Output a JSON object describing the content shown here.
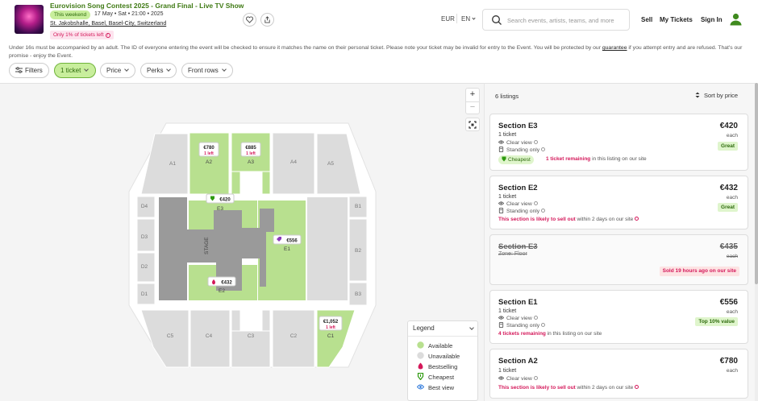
{
  "event": {
    "title": "Eurovision Song Contest 2025 - Grand Final - Live TV Show",
    "badge": "This weekend",
    "date": "17 May • Sat • 21:00 • 2025",
    "venue": "St. Jakobshalle, Basel, Basel-City, Switzerland",
    "tickets_left": "Only 1% of tickets left"
  },
  "header": {
    "currency": "EUR",
    "language": "EN",
    "search_placeholder": "Search events, artists, teams, and more",
    "nav": [
      "Sell",
      "My Tickets",
      "Sign In"
    ]
  },
  "notice": {
    "text_before": "Under 16s must be accompanied by an adult. The ID of everyone entering the event will be checked to ensure it matches the name on their personal ticket. Please note your ticket may be invalid for entry to the Event. You will be protected by our ",
    "link": "guarantee",
    "text_after": " if you attempt entry and are refused. That's our promise - enjoy the Event."
  },
  "filters": [
    "Filters",
    "1 ticket",
    "Price",
    "Perks",
    "Front rows"
  ],
  "map": {
    "stage_label": "STAGE",
    "sections": {
      "A1": "A1",
      "A2": "A2",
      "A3": "A3",
      "A4": "A4",
      "A5": "A5",
      "D4": "D4",
      "D3": "D3",
      "D2": "D2",
      "D1": "D1",
      "B1": "B1",
      "B2": "B2",
      "B3": "B3",
      "E1": "E1",
      "E2": "E2",
      "E3": "E3",
      "C1": "C1",
      "C2": "C2",
      "C3": "C3",
      "C4": "C4",
      "C5": "C5"
    },
    "pins": {
      "a2": {
        "price": "€780",
        "sub": "1 left"
      },
      "a3": {
        "price": "€885",
        "sub": "1 left"
      },
      "c1": {
        "price": "€1,052",
        "sub": "1 left"
      },
      "e3": {
        "price": "€420"
      },
      "e1": {
        "price": "€556"
      },
      "e2": {
        "price": "€432"
      }
    },
    "colors": {
      "available": "#b8e08f",
      "unavailable": "#dcdcdc",
      "stage": "#9a9a9a",
      "brand": "#6fb33a",
      "pink": "#d4185a"
    }
  },
  "legend": {
    "title": "Legend",
    "items": [
      "Available",
      "Unavailable",
      "Bestselling",
      "Cheapest",
      "Best view"
    ]
  },
  "listings": {
    "count": "6 listings",
    "sort": "Sort by price",
    "cards": [
      {
        "section": "Section E3",
        "qty": "1 ticket",
        "price": "€420",
        "each": "each",
        "features": [
          "Clear view",
          "Standing only"
        ],
        "badge": "Great",
        "cheapest": "Cheapest",
        "note_bold": "1 ticket remaining",
        "note": " in this listing on our site"
      },
      {
        "section": "Section E2",
        "qty": "1 ticket",
        "price": "€432",
        "each": "each",
        "features": [
          "Clear view",
          "Standing only"
        ],
        "badge": "Great",
        "note_bold": "This section is likely to sell out",
        "note": " within 2 days on our site"
      },
      {
        "section": "Section E3",
        "zone": "Zone: Floor",
        "price": "€435",
        "each": "each",
        "sold": "Sold 19 hours ago on our site"
      },
      {
        "section": "Section E1",
        "qty": "1 ticket",
        "price": "€556",
        "each": "each",
        "features": [
          "Clear view",
          "Standing only"
        ],
        "badge": "Top 10% value",
        "note_bold": "4 tickets remaining",
        "note": " in this listing on our site"
      },
      {
        "section": "Section A2",
        "qty": "1 ticket",
        "price": "€780",
        "each": "each",
        "features": [
          "Clear view"
        ],
        "note_bold": "This section is likely to sell out",
        "note": " within 2 days on our site"
      }
    ]
  }
}
